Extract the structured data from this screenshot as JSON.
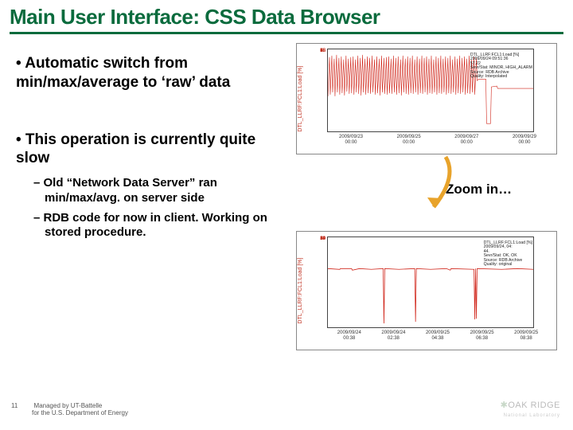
{
  "title": "Main User Interface: CSS Data Browser",
  "bullets": {
    "b1": "• Automatic switch from min/max/average to ‘raw’ data",
    "b2": "• This operation is currently quite slow",
    "sub1": "– Old “Network Data Server” ran min/max/avg. on server side",
    "sub2": "– RDB code for now in client. Working on stored procedure."
  },
  "zoom_label": "Zoom in…",
  "footer": {
    "page": "11",
    "line1": "Managed by UT-Battelle",
    "line2": "for the U.S. Department of Energy"
  },
  "logo": {
    "name": "OAK RIDGE",
    "sub": "National Laboratory"
  },
  "chart_data": [
    {
      "type": "line",
      "title": "",
      "ylabel": "DTL_LLRF:FCL1:Load [%]",
      "ylim": [
        18,
        98
      ],
      "yticks": [
        18,
        28,
        38,
        48,
        58,
        68,
        78,
        88,
        98
      ],
      "xticks": [
        {
          "d": "2009/09/23",
          "t": "00:00"
        },
        {
          "d": "2009/09/25",
          "t": "00:00"
        },
        {
          "d": "2009/09/27",
          "t": "00:00"
        },
        {
          "d": "2009/09/29",
          "t": "00:00"
        }
      ],
      "info": [
        "DTL_LLRF:FCL1:Load [%]",
        "2009/09/24 09:51:36",
        "57.22",
        "Sevr/Stat: MINOR, HIGH_ALARM",
        "Source: RDB Archive",
        "Quality: Interpolated"
      ],
      "note": "dense noisy min/max/avg envelope roughly 50–95 across range, drops to ~25 near end then flat ~60"
    },
    {
      "type": "line",
      "title": "",
      "ylabel": "DTL_LLRF:FCL1:Load [%]",
      "ylim": [
        19,
        59
      ],
      "yticks": [
        19,
        24,
        29,
        34,
        39,
        44,
        49,
        54,
        59
      ],
      "xticks": [
        {
          "d": "2009/09/24",
          "t": "00:38"
        },
        {
          "d": "2009/09/24",
          "t": "02:38"
        },
        {
          "d": "2009/09/25",
          "t": "04:38"
        },
        {
          "d": "2009/09/25",
          "t": "06:38"
        },
        {
          "d": "2009/09/25",
          "t": "08:38"
        }
      ],
      "info": [
        "DTL_LLRF:FCL1:Load [%]",
        "2009/09/24, 04:",
        "44.",
        "Sevr/Stat: OK, OK",
        "Source: RDB Archive",
        "Quality: original"
      ],
      "note": "raw data mostly flat ~45 with a few deep downward spikes to ~20"
    }
  ]
}
